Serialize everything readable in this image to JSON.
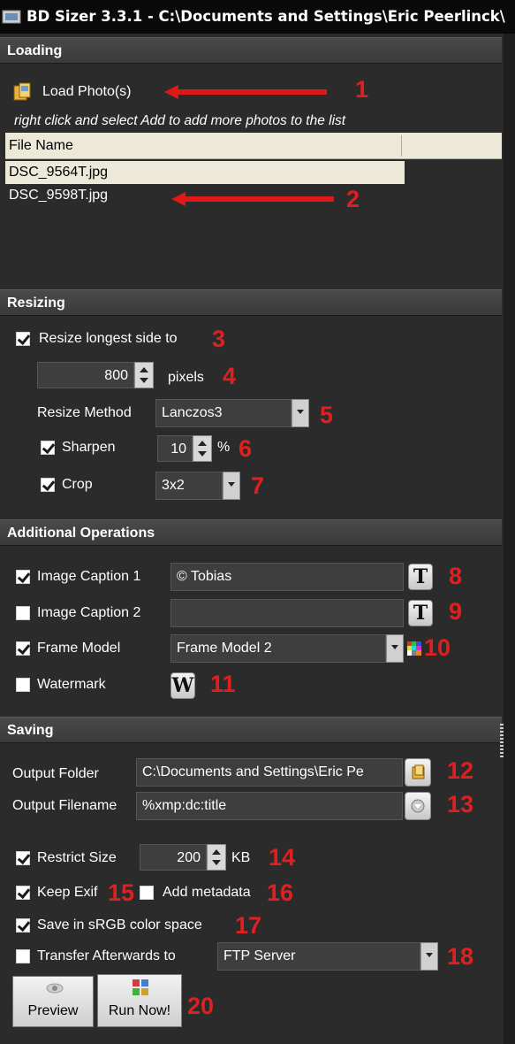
{
  "window": {
    "title": "BD Sizer 3.3.1 - C:\\Documents and Settings\\Eric Peerlinck\\"
  },
  "sections": {
    "loading": "Loading",
    "resizing": "Resizing",
    "additional": "Additional Operations",
    "saving": "Saving"
  },
  "loading": {
    "load_button": "Load Photo(s)",
    "hint": "right click and select Add to add more photos to the list",
    "column_header": "File Name",
    "files": [
      "DSC_9564T.jpg",
      "DSC_9598T.jpg"
    ],
    "selected_index": 0
  },
  "resizing": {
    "resize_label": "Resize longest side to",
    "resize_checked": true,
    "size_value": "800",
    "size_unit": "pixels",
    "method_label": "Resize Method",
    "method_value": "Lanczos3",
    "sharpen_label": "Sharpen",
    "sharpen_checked": true,
    "sharpen_value": "10",
    "sharpen_unit": "%",
    "crop_label": "Crop",
    "crop_checked": true,
    "crop_value": "3x2"
  },
  "additional": {
    "caption1_label": "Image Caption 1",
    "caption1_checked": true,
    "caption1_value": "© Tobias",
    "caption2_label": "Image Caption 2",
    "caption2_checked": false,
    "caption2_value": "",
    "text_button": "T",
    "frame_label": "Frame Model",
    "frame_checked": true,
    "frame_value": "Frame Model 2",
    "watermark_label": "Watermark",
    "watermark_checked": false,
    "watermark_button": "W"
  },
  "saving": {
    "output_folder_label": "Output Folder",
    "output_folder_value": "C:\\Documents and Settings\\Eric Pe",
    "output_filename_label": "Output Filename",
    "output_filename_value": "%xmp:dc:title",
    "restrict_label": "Restrict Size",
    "restrict_checked": true,
    "restrict_value": "200",
    "restrict_unit": "KB",
    "keep_exif_label": "Keep Exif",
    "keep_exif_checked": true,
    "add_metadata_label": "Add metadata",
    "add_metadata_checked": false,
    "srgb_label": "Save in sRGB color space",
    "srgb_checked": true,
    "transfer_label": "Transfer Afterwards to",
    "transfer_checked": false,
    "transfer_value": "FTP Server",
    "preview_button": "Preview",
    "run_button": "Run Now!"
  },
  "annotations": [
    "1",
    "2",
    "3",
    "4",
    "5",
    "6",
    "7",
    "8",
    "9",
    "10",
    "11",
    "12",
    "13",
    "14",
    "15",
    "16",
    "17",
    "18",
    "20"
  ],
  "colors": {
    "annotation": "#e02020",
    "panel_bg": "#2b2b2b",
    "list_bg": "#ece9d8"
  },
  "icons": {
    "app": "app-icon",
    "load": "folder-photo-icon",
    "browse": "folder-icon",
    "filename_picker": "circle-arrow-icon",
    "palette": "color-grid-icon",
    "preview": "eye-icon",
    "run": "run-icon"
  }
}
